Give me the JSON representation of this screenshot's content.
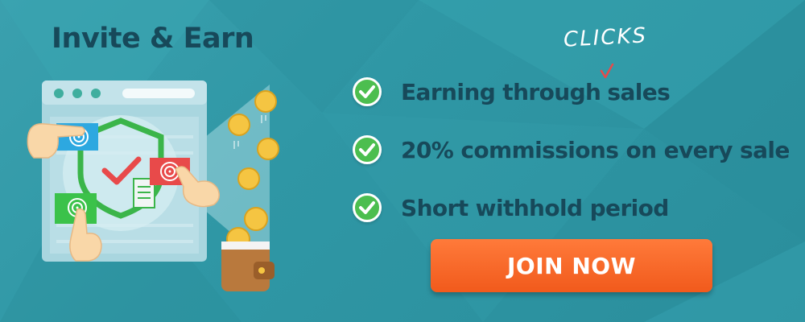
{
  "banner": {
    "title": "Invite & Earn",
    "handwritten_note": "CLICKS",
    "features": [
      {
        "before": "Earning through",
        "after": "sales"
      },
      {
        "text": "20% commissions on every sale"
      },
      {
        "text": "Short withhold period"
      }
    ],
    "cta_label": "JOIN NOW"
  },
  "colors": {
    "background": "#2f97a5",
    "title_text": "#17495a",
    "check_green": "#4cbe4f",
    "cta_orange": "#f15a1c",
    "coin_gold": "#f5c542",
    "shield_green": "#3bb54a",
    "correction_red": "#e84a4a"
  },
  "icons": [
    "check-circle-icon",
    "shield-check-icon",
    "fingerprint-icon",
    "coin-icon",
    "wallet-icon",
    "pointing-hand-icon",
    "browser-window-icon",
    "document-icon"
  ]
}
